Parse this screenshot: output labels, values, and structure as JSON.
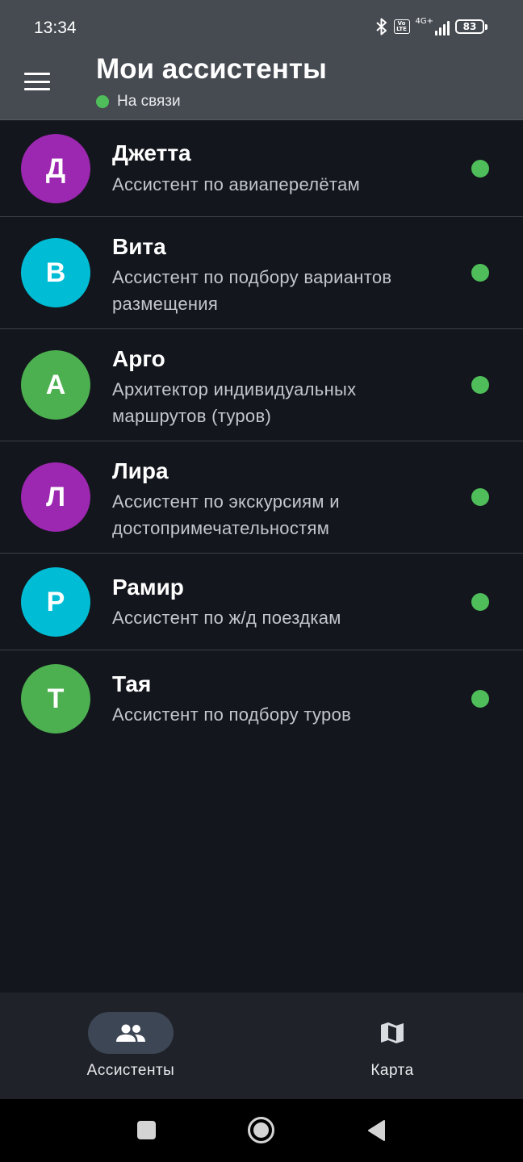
{
  "status_bar": {
    "time": "13:34",
    "volte": "Vo LTE",
    "network": "4G+",
    "battery": "83",
    "icons": [
      "bluetooth-icon",
      "volte-icon",
      "signal-icon",
      "battery-icon"
    ]
  },
  "header": {
    "title": "Мои ассистенты",
    "connection_status": "На связи",
    "menu_icon": "hamburger-menu-icon"
  },
  "assistants": [
    {
      "initial": "Д",
      "name": "Джетта",
      "description": "Ассистент по авиаперелётам",
      "color": "#9c27b0",
      "online": true
    },
    {
      "initial": "В",
      "name": "Вита",
      "description": "Ассистент по подбору вариантов размещения",
      "color": "#00bcd4",
      "online": true
    },
    {
      "initial": "А",
      "name": "Арго",
      "description": "Архитектор индивидуальных маршрутов (туров)",
      "color": "#4caf50",
      "online": true
    },
    {
      "initial": "Л",
      "name": "Лира",
      "description": "Ассистент по экскурсиям и достопримечательностям",
      "color": "#9c27b0",
      "online": true
    },
    {
      "initial": "Р",
      "name": "Рамир",
      "description": "Ассистент по ж/д поездкам",
      "color": "#00bcd4",
      "online": true
    },
    {
      "initial": "Т",
      "name": "Тая",
      "description": "Ассистент по подбору туров",
      "color": "#4caf50",
      "online": true
    }
  ],
  "bottom_nav": {
    "tabs": [
      {
        "label": "Ассистенты",
        "icon": "people-icon",
        "selected": true
      },
      {
        "label": "Карта",
        "icon": "map-icon",
        "selected": false
      }
    ]
  },
  "system_nav": [
    "recents-icon",
    "home-icon",
    "back-icon"
  ],
  "colors": {
    "header_bg": "#464a51",
    "background": "#13161c",
    "online_green": "#4ebd5a",
    "nav_pill": "#3d4655"
  }
}
